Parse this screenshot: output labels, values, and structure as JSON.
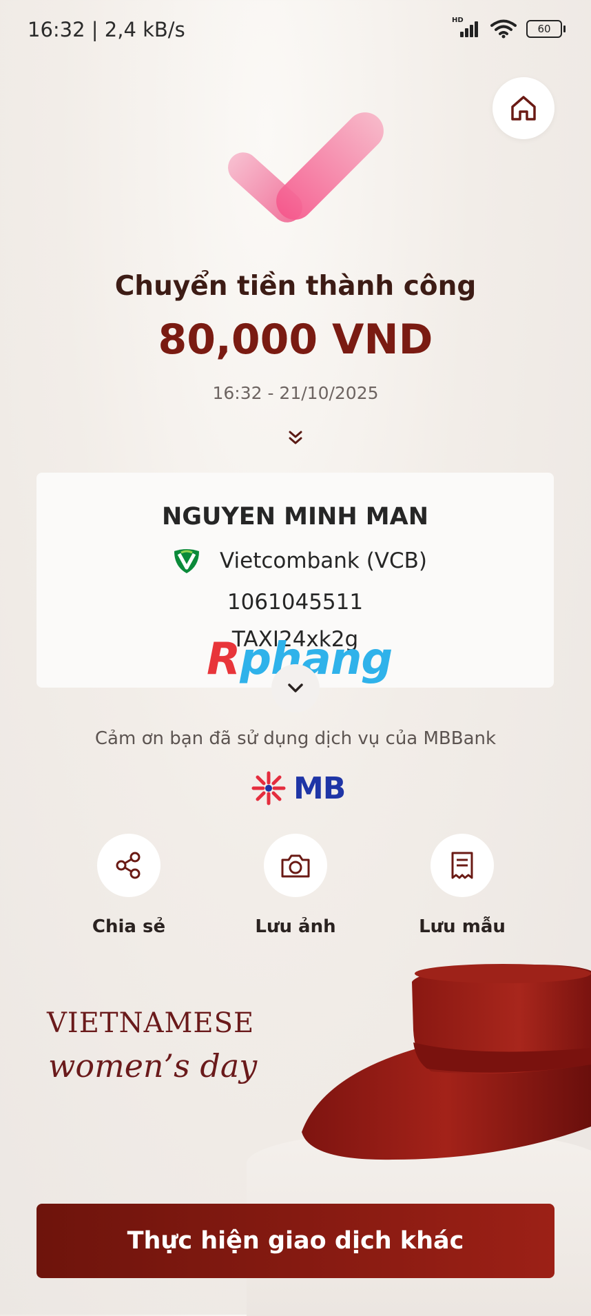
{
  "status_bar": {
    "time_speed": "16:32 | 2,4 kB/s",
    "network_badge": "HD",
    "battery": "60"
  },
  "header": {
    "home_icon": "home-icon"
  },
  "result": {
    "title": "Chuyển tiền thành công",
    "amount": "80,000 VND",
    "datetime": "16:32 - 21/10/2025"
  },
  "recipient": {
    "name": "NGUYEN MINH MAN",
    "bank": "Vietcombank (VCB)",
    "account": "1061045511",
    "memo": "TAXI24xk2g"
  },
  "watermark": {
    "first": "R",
    "rest": "phang"
  },
  "footer_note": {
    "thanks": "Cảm ơn bạn đã sử dụng dịch vụ của MBBank",
    "brand": "MB"
  },
  "actions": [
    {
      "label": "Chia sẻ",
      "icon": "share-icon"
    },
    {
      "label": "Lưu ảnh",
      "icon": "camera-icon"
    },
    {
      "label": "Lưu mẫu",
      "icon": "receipt-icon"
    }
  ],
  "banner": {
    "line1": "VIETNAMESE",
    "line2": "women’s day"
  },
  "cta": {
    "label": "Thực hiện giao dịch khác"
  },
  "colors": {
    "accent": "#7a1b12",
    "cta_start": "#6e140c",
    "cta_end": "#9c2016",
    "check_pink": "#f06894",
    "mb_blue": "#1f35a6",
    "mb_red": "#e42d3e",
    "vcb_green": "#0b8a3a"
  }
}
